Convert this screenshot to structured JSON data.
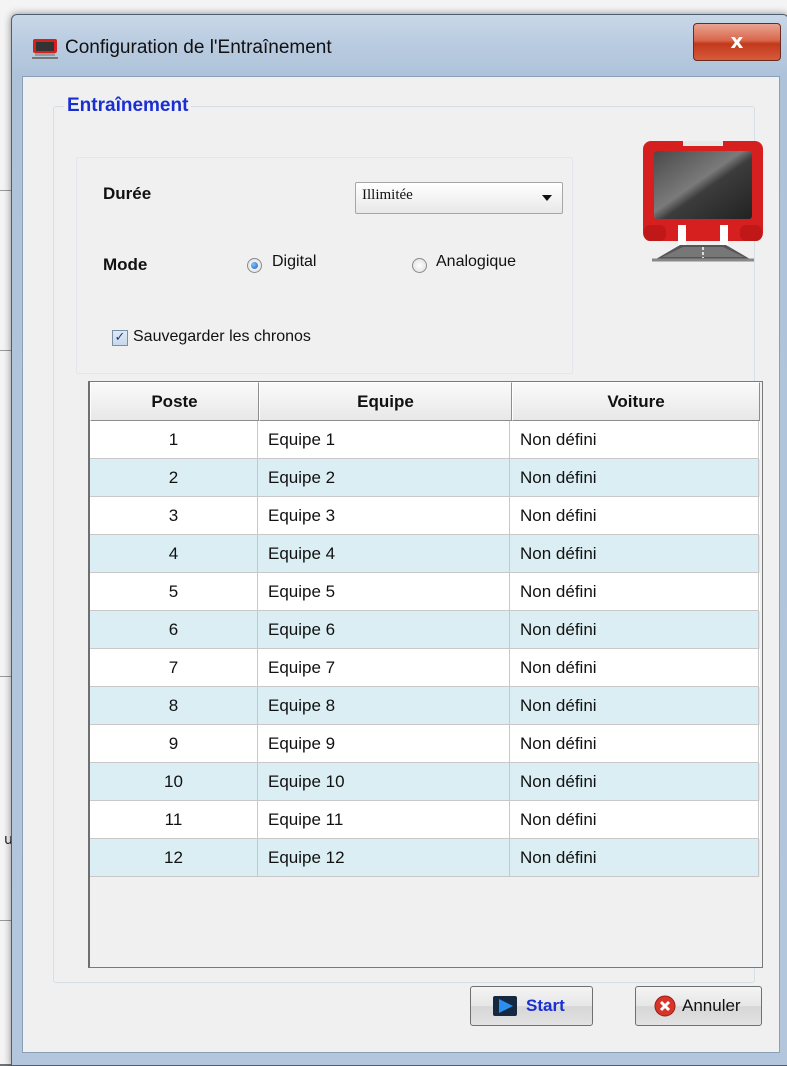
{
  "window": {
    "title": "Configuration de l'Entraînement",
    "close_label": "x"
  },
  "group": {
    "legend": "Entraînement"
  },
  "settings": {
    "duree_label": "Durée",
    "duree_value": "Illimitée",
    "mode_label": "Mode",
    "mode_options": [
      {
        "label": "Digital",
        "selected": true
      },
      {
        "label": "Analogique",
        "selected": false
      }
    ],
    "save_checkbox_label": "Sauvegarder les chronos",
    "save_checked": true
  },
  "table": {
    "headers": [
      "Poste",
      "Equipe",
      "Voiture"
    ],
    "rows": [
      [
        "1",
        "Equipe 1",
        "Non défini"
      ],
      [
        "2",
        "Equipe 2",
        "Non défini"
      ],
      [
        "3",
        "Equipe 3",
        "Non défini"
      ],
      [
        "4",
        "Equipe 4",
        "Non défini"
      ],
      [
        "5",
        "Equipe 5",
        "Non défini"
      ],
      [
        "6",
        "Equipe 6",
        "Non défini"
      ],
      [
        "7",
        "Equipe 7",
        "Non défini"
      ],
      [
        "8",
        "Equipe 8",
        "Non défini"
      ],
      [
        "9",
        "Equipe 9",
        "Non défini"
      ],
      [
        "10",
        "Equipe 10",
        "Non défini"
      ],
      [
        "11",
        "Equipe 11",
        "Non défini"
      ],
      [
        "12",
        "Equipe 12",
        "Non défini"
      ]
    ],
    "alt_row_color": "#daeef3"
  },
  "buttons": {
    "start_label": "Start",
    "cancel_label": "Annuler"
  },
  "background": {
    "edge_char": "u"
  },
  "colors": {
    "legend": "#1a2fd1",
    "start_text": "#1a2fd1",
    "close": "#c2391c",
    "logo_red": "#d62020"
  },
  "icons": {
    "app": "app-logo-icon",
    "close": "close-icon",
    "start": "play-icon",
    "cancel": "cancel-icon"
  }
}
